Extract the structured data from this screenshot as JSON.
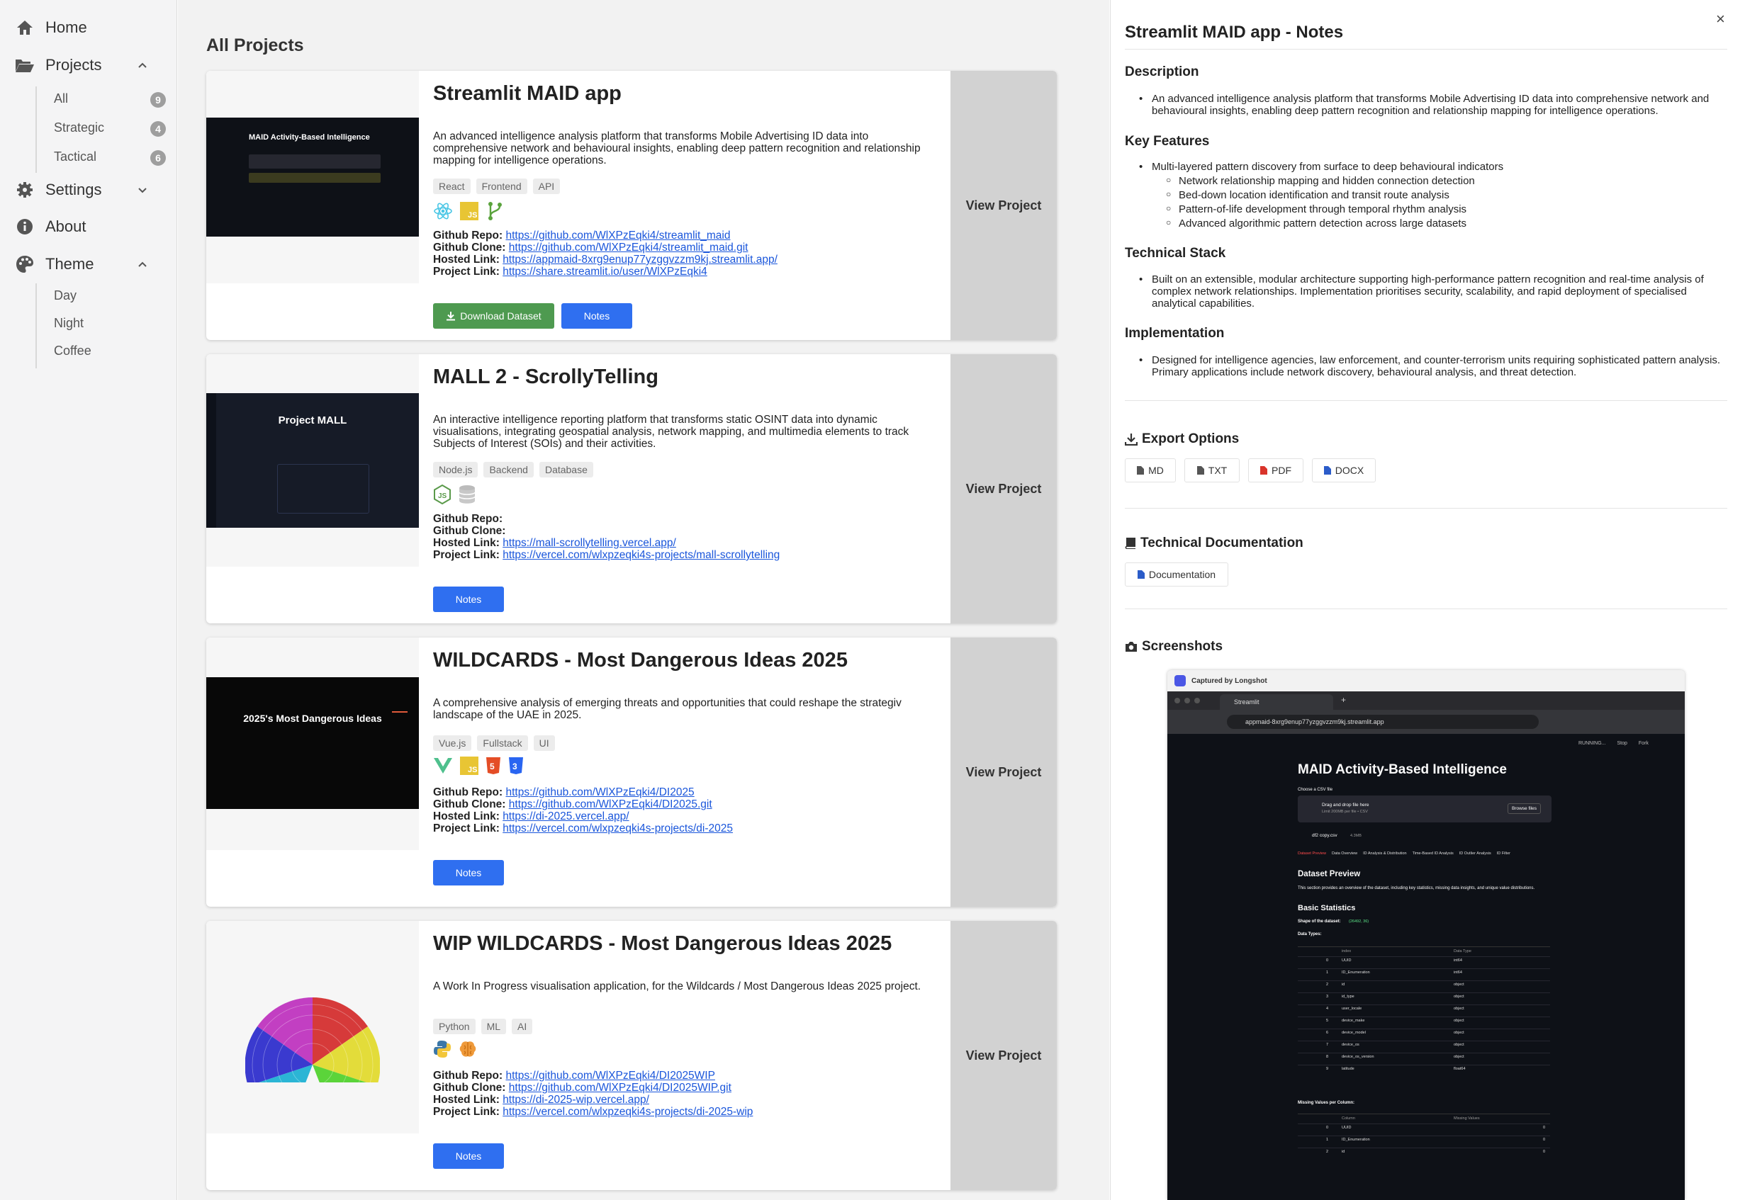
{
  "sidebar": {
    "home": "Home",
    "projects": "Projects",
    "project_filters": [
      {
        "label": "All",
        "count": "9"
      },
      {
        "label": "Strategic",
        "count": "4"
      },
      {
        "label": "Tactical",
        "count": "6"
      }
    ],
    "settings": "Settings",
    "about": "About",
    "theme": "Theme",
    "themes": [
      "Day",
      "Night",
      "Coffee"
    ]
  },
  "main": {
    "title": "All Projects",
    "view_label": "View Project",
    "notes_label": "Notes",
    "download_label": "Download Dataset",
    "link_labels": {
      "repo": "Github Repo:",
      "clone": "Github Clone:",
      "hosted": "Hosted Link:",
      "project": "Project Link:"
    },
    "projects": [
      {
        "title": "Streamlit MAID app",
        "description": "An advanced intelligence analysis platform that transforms Mobile Advertising ID data into comprehensive network and behavioural insights, enabling deep pattern recognition and relationship mapping for intelligence operations.",
        "tags": [
          "React",
          "Frontend",
          "API"
        ],
        "icons": [
          "react-icon",
          "javascript-icon",
          "git-branch-icon"
        ],
        "repo": "https://github.com/WlXPzEqki4/streamlit_maid",
        "clone": "https://github.com/WlXPzEqki4/streamlit_maid.git",
        "hosted": "https://appmaid-8xrg9enup77yzggvzzm9kj.streamlit.app/",
        "project": "https://share.streamlit.io/user/WlXPzEqki4",
        "thumb_title": "MAID Activity-Based Intelligence"
      },
      {
        "title": "MALL 2 - ScrollyTelling",
        "description": "An interactive intelligence reporting platform that transforms static OSINT data into dynamic visualisations, integrating geospatial analysis, network mapping, and multimedia elements to track Subjects of Interest (SOIs) and their activities.",
        "tags": [
          "Node.js",
          "Backend",
          "Database"
        ],
        "icons": [
          "nodejs-icon",
          "database-icon"
        ],
        "repo": "",
        "clone": "",
        "hosted": "https://mall-scrollytelling.vercel.app/",
        "project": "https://vercel.com/wlxpzeqki4s-projects/mall-scrollytelling",
        "thumb_title": "Project MALL"
      },
      {
        "title": "WILDCARDS - Most Dangerous Ideas 2025",
        "description": "A comprehensive analysis of emerging threats and opportunities that could reshape the strategiv landscape of the UAE in 2025.",
        "tags": [
          "Vue.js",
          "Fullstack",
          "UI"
        ],
        "icons": [
          "vue-icon",
          "javascript-icon",
          "html5-icon",
          "css3-icon"
        ],
        "repo": "https://github.com/WlXPzEqki4/DI2025",
        "clone": "https://github.com/WlXPzEqki4/DI2025.git",
        "hosted": "https://di-2025.vercel.app/",
        "project": "https://vercel.com/wlxpzeqki4s-projects/di-2025",
        "thumb_title": "2025's Most Dangerous Ideas"
      },
      {
        "title": "WIP WILDCARDS - Most Dangerous Ideas 2025",
        "description": "A Work In Progress visualisation application, for the Wildcards / Most Dangerous Ideas 2025 project.",
        "tags": [
          "Python",
          "ML",
          "AI"
        ],
        "icons": [
          "python-icon",
          "brain-icon"
        ],
        "repo": "https://github.com/WlXPzEqki4/DI2025WIP",
        "clone": "https://github.com/WlXPzEqki4/DI2025WIP.git",
        "hosted": "https://di-2025-wip.vercel.app/",
        "project": "https://vercel.com/wlxpzeqki4s-projects/di-2025-wip"
      }
    ]
  },
  "notes": {
    "title": "Streamlit MAID app - Notes",
    "close": "×",
    "description_h": "Description",
    "description": "An advanced intelligence analysis platform that transforms Mobile Advertising ID data into comprehensive network and behavioural insights, enabling deep pattern recognition and relationship mapping for intelligence operations.",
    "features_h": "Key Features",
    "features_main": "Multi-layered pattern discovery from surface to deep behavioural indicators",
    "features_sub": [
      "Network relationship mapping and hidden connection detection",
      "Bed-down location identification and transit route analysis",
      "Pattern-of-life development through temporal rhythm analysis",
      "Advanced algorithmic pattern detection across large datasets"
    ],
    "stack_h": "Technical Stack",
    "stack": "Built on an extensible, modular architecture supporting high-performance pattern recognition and real-time analysis of complex network relationships. Implementation prioritises security, scalability, and rapid deployment of specialised analytical capabilities.",
    "impl_h": "Implementation",
    "impl": "Designed for intelligence agencies, law enforcement, and counter-terrorism units requiring sophisticated pattern analysis. Primary applications include network discovery, behavioural analysis, and threat detection.",
    "export_h": "Export Options",
    "export_buttons": [
      "MD",
      "TXT",
      "PDF",
      "DOCX"
    ],
    "docs_h": "Technical Documentation",
    "docs_button": "Documentation",
    "shots_h": "Screenshots",
    "shot": {
      "captured_by": "Captured by Longshot",
      "tab": "Streamlit",
      "url": "appmaid-8xrg9enup77yzggvzzm9kj.streamlit.app",
      "app_title": "MAID Activity-Based Intelligence",
      "choose_file": "Choose a CSV file",
      "drag_drop": "Drag and drop file here",
      "limit": "Limit 200MB per file • CSV",
      "browse": "Browse files",
      "file_name": "df2 copy.csv",
      "file_size": "4.3MB",
      "top_actions": [
        "RUNNING...",
        "Stop",
        "Fork"
      ],
      "tabs": [
        "Dataset Preview",
        "Data Overview",
        "ID Analysis & Distribution",
        "Time-Based ID Analysis",
        "ID Outlier Analysis",
        "ID Filter"
      ],
      "preview_h": "Dataset Preview",
      "preview_text": "This section provides an overview of the dataset, including key statistics, missing data insights, and unique value distributions.",
      "stats_h": "Basic Statistics",
      "shape_label": "Shape of the dataset:",
      "shape_value": "(26492, 36)",
      "dtypes_label": "Data Types:",
      "dtype_headers": [
        "index",
        "Data Type"
      ],
      "dtype_rows": [
        [
          "0",
          "UUID",
          "int64"
        ],
        [
          "1",
          "ID_Enumeration",
          "int64"
        ],
        [
          "2",
          "id",
          "object"
        ],
        [
          "3",
          "id_type",
          "object"
        ],
        [
          "4",
          "user_locale",
          "object"
        ],
        [
          "5",
          "device_make",
          "object"
        ],
        [
          "6",
          "device_model",
          "object"
        ],
        [
          "7",
          "device_os",
          "object"
        ],
        [
          "8",
          "device_os_version",
          "object"
        ],
        [
          "9",
          "latitude",
          "float64"
        ]
      ],
      "missing_label": "Missing Values per Column:",
      "missing_headers": [
        "Column",
        "Missing Values"
      ],
      "missing_rows": [
        [
          "0",
          "UUID",
          "0"
        ],
        [
          "1",
          "ID_Enumeration",
          "0"
        ],
        [
          "2",
          "id",
          "0"
        ]
      ]
    }
  },
  "colors": {
    "accent_blue": "#2f6ff0",
    "download_green": "#4e9a50",
    "link_blue": "#1a56db",
    "view_panel": "#d2d2d2",
    "streamlit_dark": "#0e1117"
  }
}
